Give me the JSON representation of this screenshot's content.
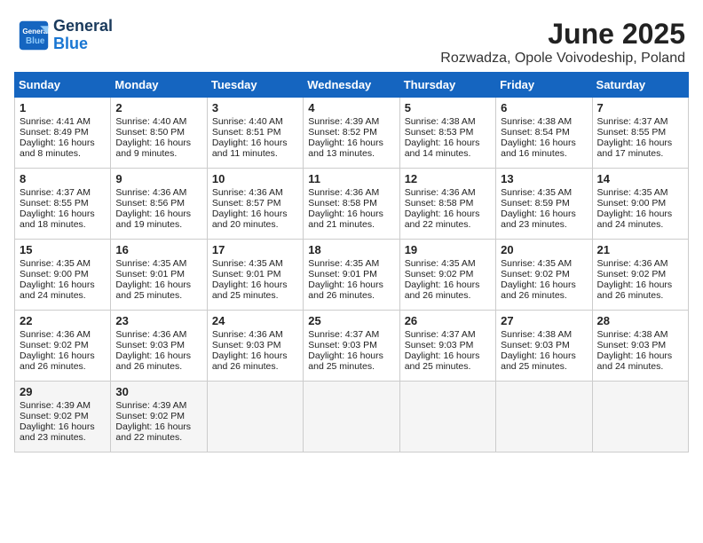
{
  "header": {
    "logo_line1": "General",
    "logo_line2": "Blue",
    "month_year": "June 2025",
    "location": "Rozwadza, Opole Voivodeship, Poland"
  },
  "days_of_week": [
    "Sunday",
    "Monday",
    "Tuesday",
    "Wednesday",
    "Thursday",
    "Friday",
    "Saturday"
  ],
  "weeks": [
    [
      {
        "day": "1",
        "info": "Sunrise: 4:41 AM\nSunset: 8:49 PM\nDaylight: 16 hours\nand 8 minutes."
      },
      {
        "day": "2",
        "info": "Sunrise: 4:40 AM\nSunset: 8:50 PM\nDaylight: 16 hours\nand 9 minutes."
      },
      {
        "day": "3",
        "info": "Sunrise: 4:40 AM\nSunset: 8:51 PM\nDaylight: 16 hours\nand 11 minutes."
      },
      {
        "day": "4",
        "info": "Sunrise: 4:39 AM\nSunset: 8:52 PM\nDaylight: 16 hours\nand 13 minutes."
      },
      {
        "day": "5",
        "info": "Sunrise: 4:38 AM\nSunset: 8:53 PM\nDaylight: 16 hours\nand 14 minutes."
      },
      {
        "day": "6",
        "info": "Sunrise: 4:38 AM\nSunset: 8:54 PM\nDaylight: 16 hours\nand 16 minutes."
      },
      {
        "day": "7",
        "info": "Sunrise: 4:37 AM\nSunset: 8:55 PM\nDaylight: 16 hours\nand 17 minutes."
      }
    ],
    [
      {
        "day": "8",
        "info": "Sunrise: 4:37 AM\nSunset: 8:55 PM\nDaylight: 16 hours\nand 18 minutes."
      },
      {
        "day": "9",
        "info": "Sunrise: 4:36 AM\nSunset: 8:56 PM\nDaylight: 16 hours\nand 19 minutes."
      },
      {
        "day": "10",
        "info": "Sunrise: 4:36 AM\nSunset: 8:57 PM\nDaylight: 16 hours\nand 20 minutes."
      },
      {
        "day": "11",
        "info": "Sunrise: 4:36 AM\nSunset: 8:58 PM\nDaylight: 16 hours\nand 21 minutes."
      },
      {
        "day": "12",
        "info": "Sunrise: 4:36 AM\nSunset: 8:58 PM\nDaylight: 16 hours\nand 22 minutes."
      },
      {
        "day": "13",
        "info": "Sunrise: 4:35 AM\nSunset: 8:59 PM\nDaylight: 16 hours\nand 23 minutes."
      },
      {
        "day": "14",
        "info": "Sunrise: 4:35 AM\nSunset: 9:00 PM\nDaylight: 16 hours\nand 24 minutes."
      }
    ],
    [
      {
        "day": "15",
        "info": "Sunrise: 4:35 AM\nSunset: 9:00 PM\nDaylight: 16 hours\nand 24 minutes."
      },
      {
        "day": "16",
        "info": "Sunrise: 4:35 AM\nSunset: 9:01 PM\nDaylight: 16 hours\nand 25 minutes."
      },
      {
        "day": "17",
        "info": "Sunrise: 4:35 AM\nSunset: 9:01 PM\nDaylight: 16 hours\nand 25 minutes."
      },
      {
        "day": "18",
        "info": "Sunrise: 4:35 AM\nSunset: 9:01 PM\nDaylight: 16 hours\nand 26 minutes."
      },
      {
        "day": "19",
        "info": "Sunrise: 4:35 AM\nSunset: 9:02 PM\nDaylight: 16 hours\nand 26 minutes."
      },
      {
        "day": "20",
        "info": "Sunrise: 4:35 AM\nSunset: 9:02 PM\nDaylight: 16 hours\nand 26 minutes."
      },
      {
        "day": "21",
        "info": "Sunrise: 4:36 AM\nSunset: 9:02 PM\nDaylight: 16 hours\nand 26 minutes."
      }
    ],
    [
      {
        "day": "22",
        "info": "Sunrise: 4:36 AM\nSunset: 9:02 PM\nDaylight: 16 hours\nand 26 minutes."
      },
      {
        "day": "23",
        "info": "Sunrise: 4:36 AM\nSunset: 9:03 PM\nDaylight: 16 hours\nand 26 minutes."
      },
      {
        "day": "24",
        "info": "Sunrise: 4:36 AM\nSunset: 9:03 PM\nDaylight: 16 hours\nand 26 minutes."
      },
      {
        "day": "25",
        "info": "Sunrise: 4:37 AM\nSunset: 9:03 PM\nDaylight: 16 hours\nand 25 minutes."
      },
      {
        "day": "26",
        "info": "Sunrise: 4:37 AM\nSunset: 9:03 PM\nDaylight: 16 hours\nand 25 minutes."
      },
      {
        "day": "27",
        "info": "Sunrise: 4:38 AM\nSunset: 9:03 PM\nDaylight: 16 hours\nand 25 minutes."
      },
      {
        "day": "28",
        "info": "Sunrise: 4:38 AM\nSunset: 9:03 PM\nDaylight: 16 hours\nand 24 minutes."
      }
    ],
    [
      {
        "day": "29",
        "info": "Sunrise: 4:39 AM\nSunset: 9:02 PM\nDaylight: 16 hours\nand 23 minutes."
      },
      {
        "day": "30",
        "info": "Sunrise: 4:39 AM\nSunset: 9:02 PM\nDaylight: 16 hours\nand 22 minutes."
      },
      {
        "day": "",
        "info": ""
      },
      {
        "day": "",
        "info": ""
      },
      {
        "day": "",
        "info": ""
      },
      {
        "day": "",
        "info": ""
      },
      {
        "day": "",
        "info": ""
      }
    ]
  ]
}
